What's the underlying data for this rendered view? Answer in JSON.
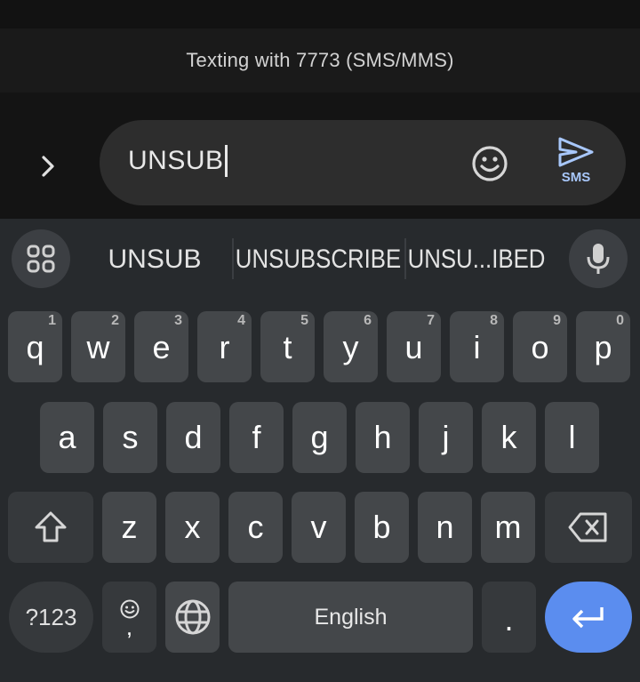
{
  "banner": {
    "text": "Texting with 7773 (SMS/MMS)"
  },
  "compose": {
    "expand_icon": "chevron-right-icon",
    "input_value": "UNSUB",
    "emoji_icon": "emoji-smile-icon",
    "send_icon": "send-icon",
    "send_label": "SMS"
  },
  "colors": {
    "accent": "#a8c7fa",
    "enter_key": "#5b8def",
    "key_bg": "#44474a",
    "keyboard_bg": "#272a2d"
  },
  "suggestions": {
    "apps_icon": "grid-apps-icon",
    "items": [
      "UNSUB",
      "UNSUBSCRIBE",
      "UNSU...IBED"
    ],
    "mic_icon": "microphone-icon"
  },
  "keyboard": {
    "row1": [
      {
        "ch": "q",
        "hint": "1"
      },
      {
        "ch": "w",
        "hint": "2"
      },
      {
        "ch": "e",
        "hint": "3"
      },
      {
        "ch": "r",
        "hint": "4"
      },
      {
        "ch": "t",
        "hint": "5"
      },
      {
        "ch": "y",
        "hint": "6"
      },
      {
        "ch": "u",
        "hint": "7"
      },
      {
        "ch": "i",
        "hint": "8"
      },
      {
        "ch": "o",
        "hint": "9"
      },
      {
        "ch": "p",
        "hint": "0"
      }
    ],
    "row2": [
      "a",
      "s",
      "d",
      "f",
      "g",
      "h",
      "j",
      "k",
      "l"
    ],
    "row3": [
      "z",
      "x",
      "c",
      "v",
      "b",
      "n",
      "m"
    ],
    "shift_icon": "shift-icon",
    "backspace_icon": "backspace-icon",
    "symbols_label": "?123",
    "comma_label": ",",
    "comma_emoji_icon": "emoji-icon",
    "globe_icon": "globe-icon",
    "space_label": "English",
    "period_label": ".",
    "enter_icon": "enter-icon"
  }
}
